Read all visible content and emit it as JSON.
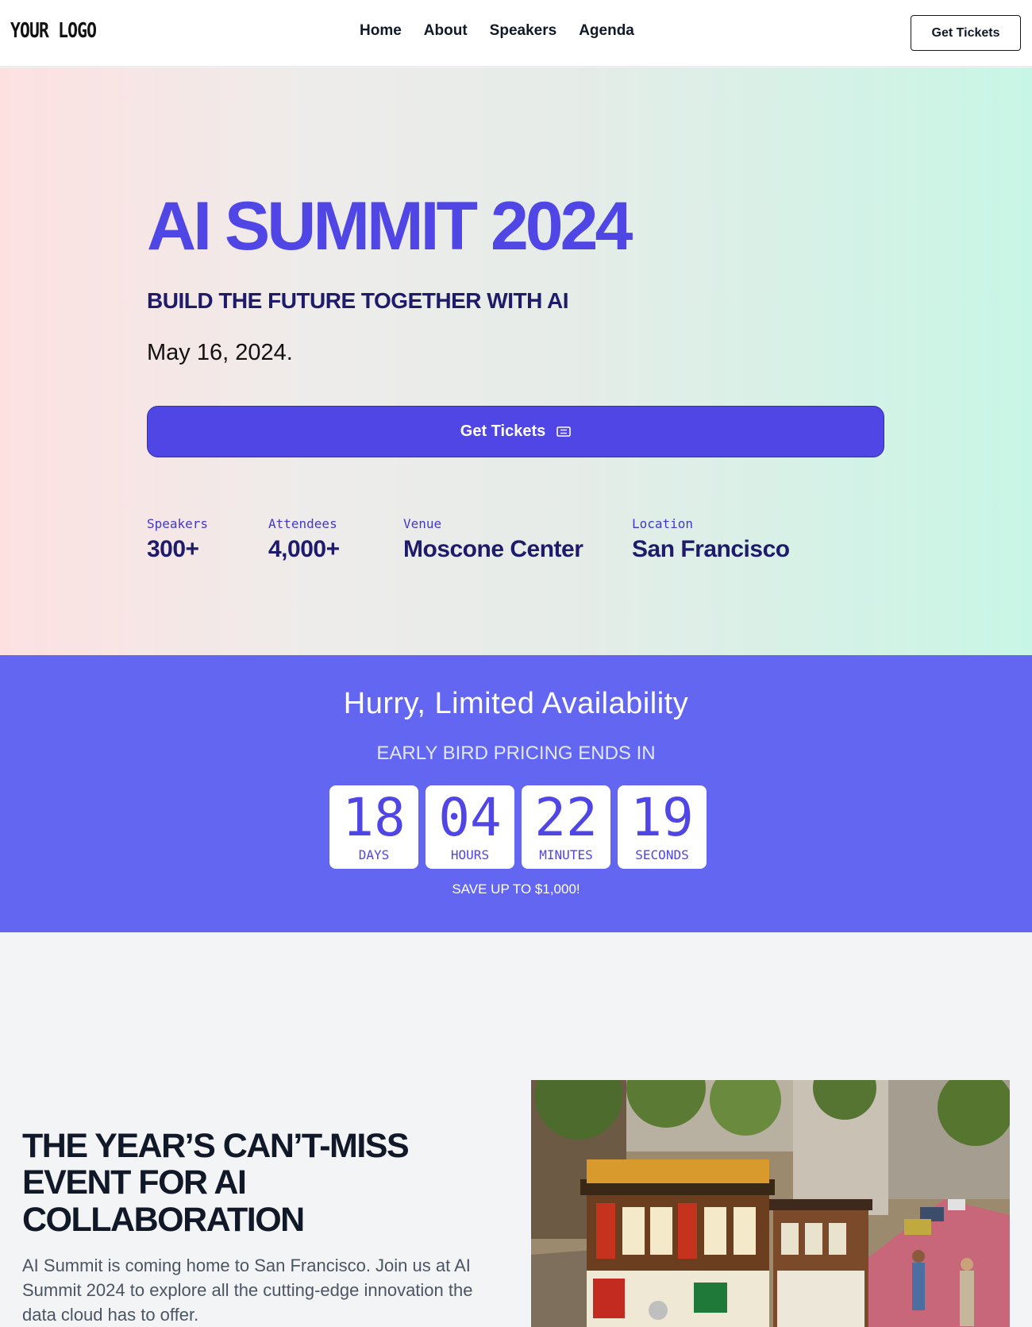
{
  "header": {
    "logo": "YOUR LOGO",
    "nav": [
      "Home",
      "About",
      "Speakers",
      "Agenda"
    ],
    "cta": "Get Tickets"
  },
  "hero": {
    "title": "AI SUMMIT 2024",
    "subtitle": "BUILD THE FUTURE TOGETHER WITH AI",
    "date": "May 16, 2024.",
    "cta": "Get Tickets",
    "cta_icon": "ticket-icon",
    "stats": [
      {
        "label": "Speakers",
        "value": "300+"
      },
      {
        "label": "Attendees",
        "value": "4,000+"
      },
      {
        "label": "Venue",
        "value": "Moscone Center"
      },
      {
        "label": "Location",
        "value": "San Francisco"
      }
    ]
  },
  "countdown": {
    "title": "Hurry, Limited Availability",
    "subtitle": "EARLY BIRD PRICING ENDS IN",
    "units": [
      {
        "value": "18",
        "label": "DAYS"
      },
      {
        "value": "04",
        "label": "HOURS"
      },
      {
        "value": "22",
        "label": "MINUTES"
      },
      {
        "value": "19",
        "label": "SECONDS"
      }
    ],
    "note": "SAVE UP TO $1,000!"
  },
  "about": {
    "title": "THE YEAR’S CAN’T-MISS EVENT FOR AI COLLABORATION",
    "text": "AI Summit is coming home to San Francisco. Join us at AI Summit 2024 to explore all the cutting-edge innovation the data cloud has to offer."
  },
  "colors": {
    "brand": "#4f46e5",
    "band": "#6366f1",
    "navy": "#1e1b6b"
  }
}
